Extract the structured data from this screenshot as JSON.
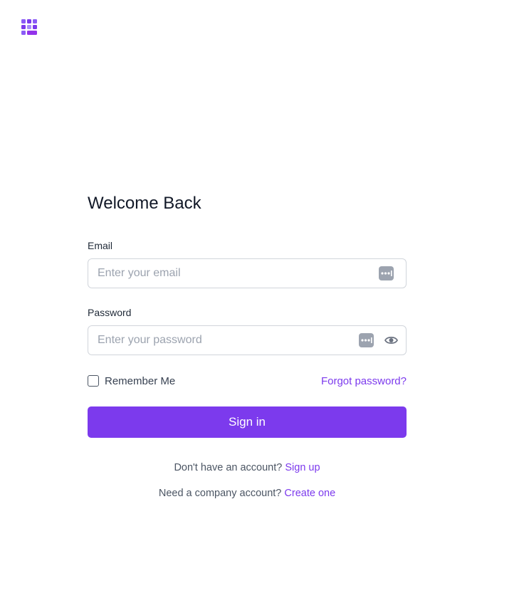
{
  "colors": {
    "accent": "#7c3aed",
    "border": "#d1d5db",
    "placeholder": "#9ca3af",
    "text": "#111827",
    "muted": "#4b5563"
  },
  "logo": {
    "icon": "grid-logo-icon"
  },
  "form": {
    "title": "Welcome Back",
    "email": {
      "label": "Email",
      "placeholder": "Enter your email",
      "value": "",
      "icon": "password-manager-icon"
    },
    "password": {
      "label": "Password",
      "placeholder": "Enter your password",
      "value": "",
      "icons": [
        "password-manager-icon",
        "eye-icon"
      ]
    },
    "remember_me": {
      "label": "Remember Me",
      "checked": false
    },
    "forgot_password": "Forgot password?",
    "sign_in": "Sign in"
  },
  "footer": {
    "signup_prompt": "Don't have an account?",
    "signup_link": "Sign up",
    "company_prompt": "Need a company account?",
    "company_link": "Create one"
  }
}
